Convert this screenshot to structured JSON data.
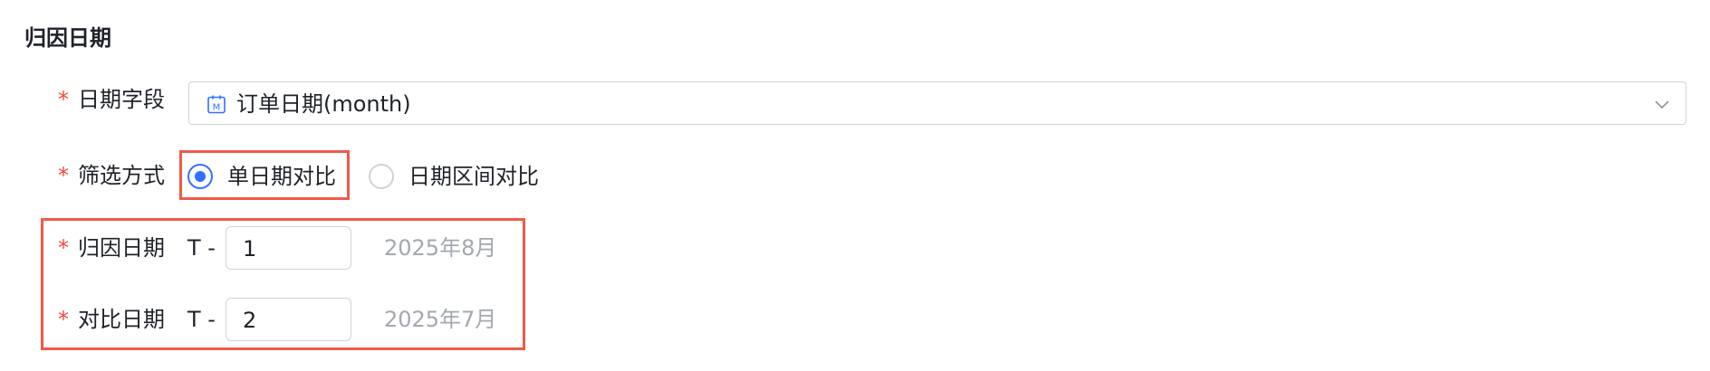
{
  "section": {
    "title": "归因日期"
  },
  "date_field": {
    "label": "日期字段",
    "required_mark": "*",
    "value": "订单日期(month)",
    "icon": "calendar-month-icon",
    "dropdown_icon": "chevron-down-icon"
  },
  "filter_mode": {
    "label": "筛选方式",
    "required_mark": "*",
    "options": [
      {
        "label": "单日期对比",
        "selected": true
      },
      {
        "label": "日期区间对比",
        "selected": false
      }
    ]
  },
  "attribution_date": {
    "label": "归因日期",
    "required_mark": "*",
    "prefix": "T -",
    "value": "1",
    "hint": "2025年8月"
  },
  "compare_date": {
    "label": "对比日期",
    "required_mark": "*",
    "prefix": "T -",
    "value": "2",
    "hint": "2025年7月"
  },
  "colors": {
    "accent": "#3370ff",
    "required": "#f5483b",
    "highlight_border": "#ee5a4a",
    "hint_text": "#a3a8b0"
  }
}
